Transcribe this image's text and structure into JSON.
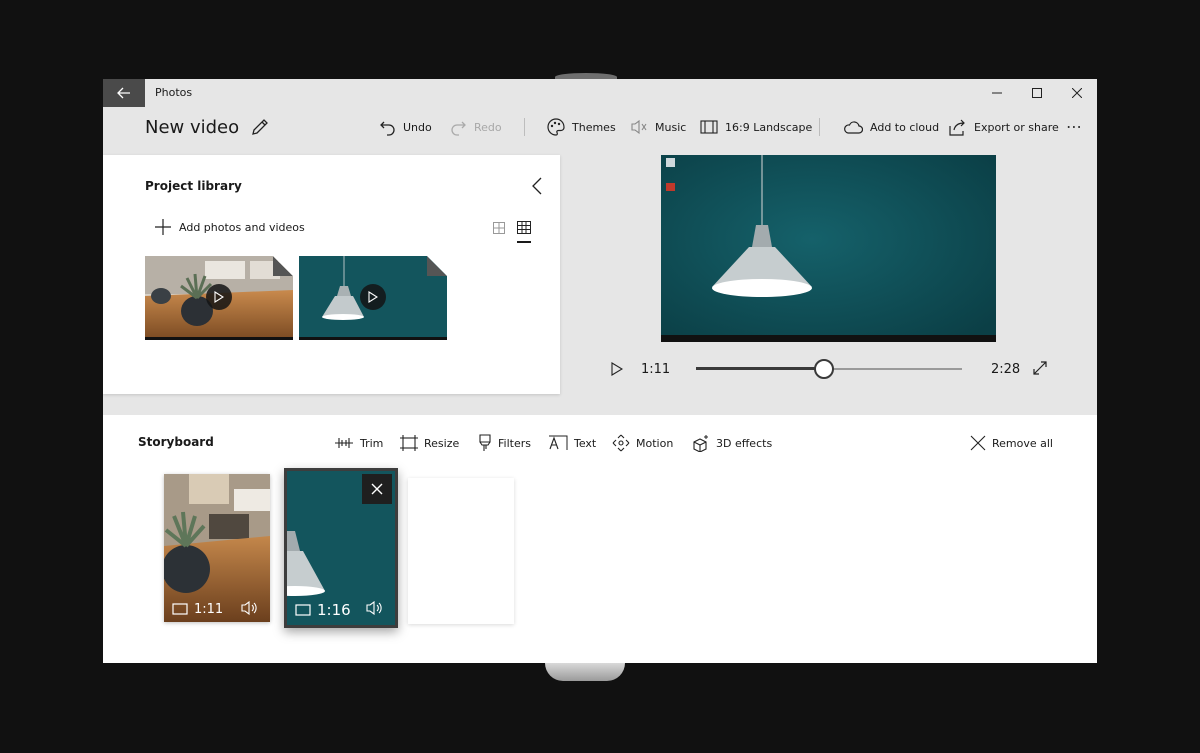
{
  "window": {
    "app_title": "Photos"
  },
  "toolbar": {
    "project_title": "New video",
    "undo": "Undo",
    "redo": "Redo",
    "themes": "Themes",
    "music": "Music",
    "aspect": "16:9 Landscape",
    "add_to_cloud": "Add to cloud",
    "export": "Export or share",
    "more": "⋯"
  },
  "library": {
    "title": "Project library",
    "add_label": "Add photos and videos",
    "items": [
      {
        "name": "plant-video"
      },
      {
        "name": "lamp-video"
      }
    ]
  },
  "player": {
    "current_time": "1:11",
    "total_time": "2:28",
    "progress": 0.48
  },
  "storyboard": {
    "title": "Storyboard",
    "tools": {
      "trim": "Trim",
      "resize": "Resize",
      "filters": "Filters",
      "text": "Text",
      "motion": "Motion",
      "effects3d": "3D effects",
      "remove_all": "Remove all"
    },
    "clips": [
      {
        "duration": "1:11",
        "selected": false
      },
      {
        "duration": "1:16",
        "selected": true
      }
    ]
  },
  "colors": {
    "accent_dark": "#3a3a3a",
    "teal": "#0f4d55",
    "panel": "#e6e6e6"
  }
}
